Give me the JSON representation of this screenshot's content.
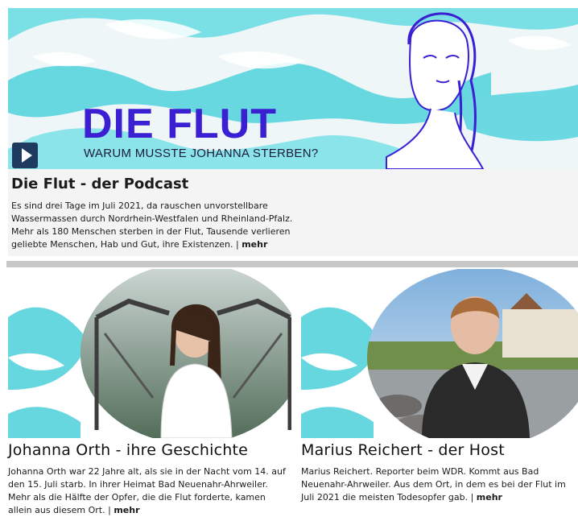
{
  "hero": {
    "title": "DIE FLUT",
    "subtitle": "WARUM MUSSTE JOHANNA STERBEN?",
    "play_icon": "play-icon",
    "accent_color": "#3a1fd3",
    "wave_color": "#66dbe3"
  },
  "podcast": {
    "title": "Die Flut - der Podcast",
    "text": "Es sind drei Tage im Juli 2021, da rauschen unvorstellbare Wassermassen durch Nordrhein-Westfalen und Rheinland-Pfalz. Mehr als 180 Menschen sterben in der Flut, Tausende verlieren geliebte Menschen, Hab und Gut, ihre Existenzen.",
    "separator": "|",
    "more": "mehr"
  },
  "cards": [
    {
      "title": "Johanna Orth - ihre Geschichte",
      "text": "Johanna Orth war 22 Jahre alt, als sie in der Nacht vom 14. auf den 15. Juli starb. In ihrer Heimat Bad Neuenahr-Ahrweiler. Mehr als die Hälfte der Opfer, die die Flut forderte, kamen allein aus diesem Ort.",
      "separator": "|",
      "more": "mehr"
    },
    {
      "title": "Marius Reichert - der Host",
      "text": "Marius Reichert. Reporter beim WDR. Kommt aus Bad Neuenahr-Ahrweiler. Aus dem Ort, in dem es bei der Flut im Juli 2021 die meisten Todesopfer gab.",
      "separator": "|",
      "more": "mehr"
    }
  ]
}
